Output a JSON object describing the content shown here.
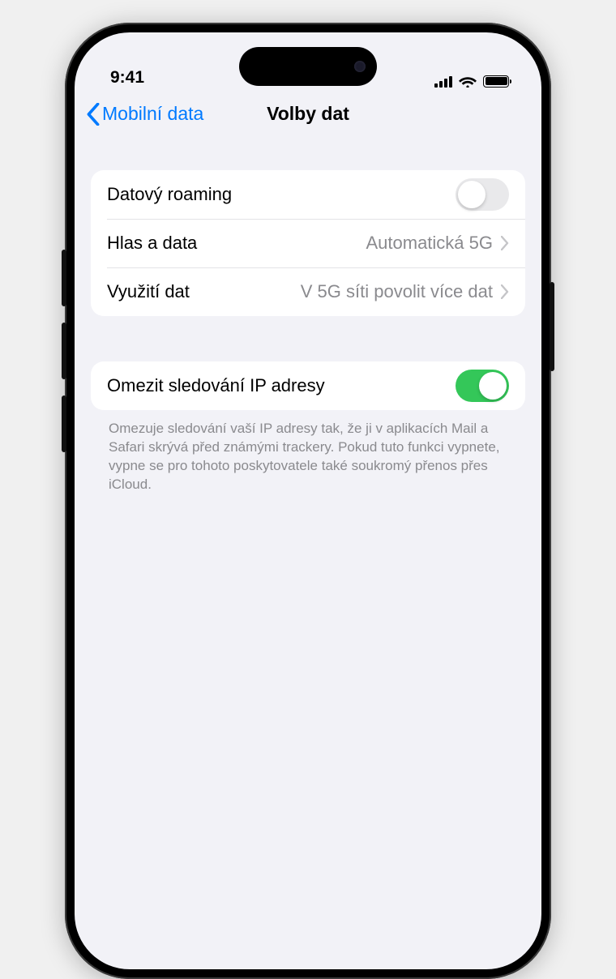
{
  "status": {
    "time": "9:41"
  },
  "nav": {
    "back": "Mobilní data",
    "title": "Volby dat"
  },
  "group1": {
    "roaming": {
      "label": "Datový roaming",
      "on": false
    },
    "voice": {
      "label": "Hlas a data",
      "value": "Automatická 5G"
    },
    "mode": {
      "label": "Využití dat",
      "value": "V 5G síti povolit více dat"
    }
  },
  "group2": {
    "limitip": {
      "label": "Omezit sledování IP adresy",
      "on": true
    },
    "footer": "Omezuje sledování vaší IP adresy tak, že ji v aplikacích Mail a Safari skrývá před známými trackery. Pokud tuto funkci vypnete, vypne se pro tohoto poskytovatele také soukromý přenos přes iCloud."
  },
  "colors": {
    "accent": "#007aff",
    "switch_on": "#34c759"
  }
}
